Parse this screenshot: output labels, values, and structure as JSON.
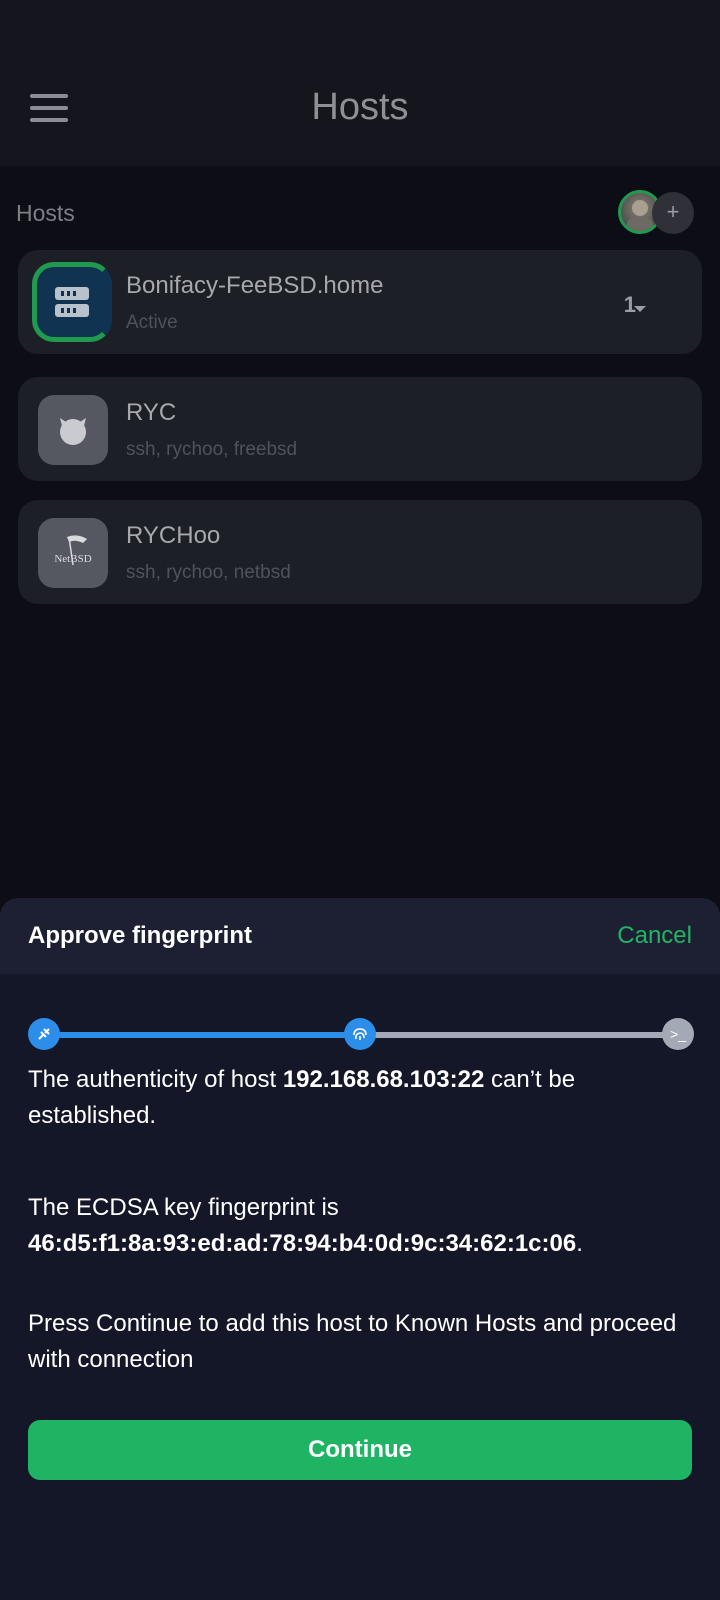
{
  "appbar": {
    "title": "Hosts"
  },
  "section": {
    "title": "Hosts",
    "add_label": "+"
  },
  "hosts": [
    {
      "name": "Bonifacy-FeeBSD.home",
      "subtitle": "Active",
      "count": "1",
      "icon": "server-icon"
    },
    {
      "name": "RYC",
      "subtitle": "ssh, rychoo, freebsd",
      "icon": "freebsd-icon"
    },
    {
      "name": "RYCHoo",
      "subtitle": "ssh, rychoo, netbsd",
      "icon": "netbsd-icon",
      "icon_text": "NetBSD"
    }
  ],
  "sheet": {
    "title": "Approve fingerprint",
    "cancel": "Cancel",
    "para1_pre": "The authenticity of host ",
    "para1_host": "192.168.68.103:22",
    "para1_post": " can’t be established.",
    "para2_pre": "The ECDSA key fingerprint is",
    "para2_fp": "46:d5:f1:8a:93:ed:ad:78:94:b4:0d:9c:34:62:1c:06",
    "para2_post": ".",
    "para3": "Press Continue to add this host to Known Hosts and proceed with connection",
    "continue": "Continue",
    "steps": [
      "plug-icon",
      "fingerprint-icon",
      "terminal-icon"
    ],
    "terminal_glyph": ">_"
  },
  "colors": {
    "accent_green": "#1fb463",
    "accent_blue": "#2d8ee9",
    "inactive_step": "#a3aab5"
  }
}
